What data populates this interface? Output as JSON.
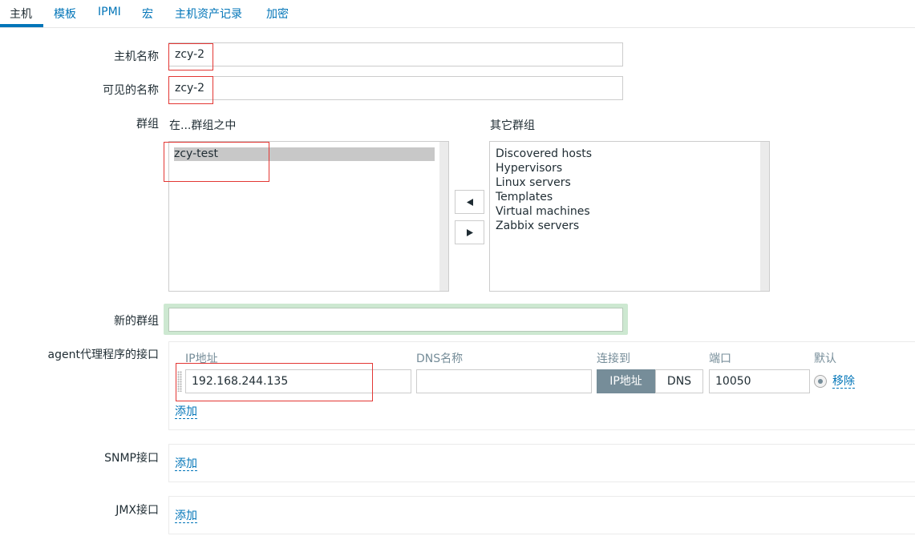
{
  "tabs": [
    {
      "label": "主机"
    },
    {
      "label": "模板"
    },
    {
      "label": "IPMI"
    },
    {
      "label": "宏"
    },
    {
      "label": "主机资产记录"
    },
    {
      "label": "加密"
    }
  ],
  "form": {
    "host_name": {
      "label": "主机名称",
      "value": "zcy-2"
    },
    "visible_name": {
      "label": "可见的名称",
      "value": "zcy-2"
    },
    "groups": {
      "label": "群组",
      "in_groups_label": "在...群组之中",
      "other_groups_label": "其它群组",
      "in_groups": [
        "zcy-test"
      ],
      "other_groups": [
        "Discovered hosts",
        "Hypervisors",
        "Linux servers",
        "Templates",
        "Virtual machines",
        "Zabbix servers"
      ]
    },
    "new_group": {
      "label": "新的群组",
      "value": ""
    },
    "agent_interfaces": {
      "label": "agent代理程序的接口",
      "headers": {
        "ip": "IP地址",
        "dns": "DNS名称",
        "connect_to": "连接到",
        "port": "端口",
        "default": "默认"
      },
      "rows": [
        {
          "ip": "192.168.244.135",
          "dns": "",
          "connect_ip": "IP地址",
          "connect_dns": "DNS",
          "port": "10050",
          "remove": "移除"
        }
      ],
      "add": "添加"
    },
    "snmp_interfaces": {
      "label": "SNMP接口",
      "add": "添加"
    },
    "jmx_interfaces": {
      "label": "JMX接口",
      "add": "添加"
    }
  },
  "colors": {
    "accent": "#0275b8",
    "highlight": "#e33734",
    "focus_glow": "#cde8d1",
    "selected_segment": "#768d99"
  }
}
